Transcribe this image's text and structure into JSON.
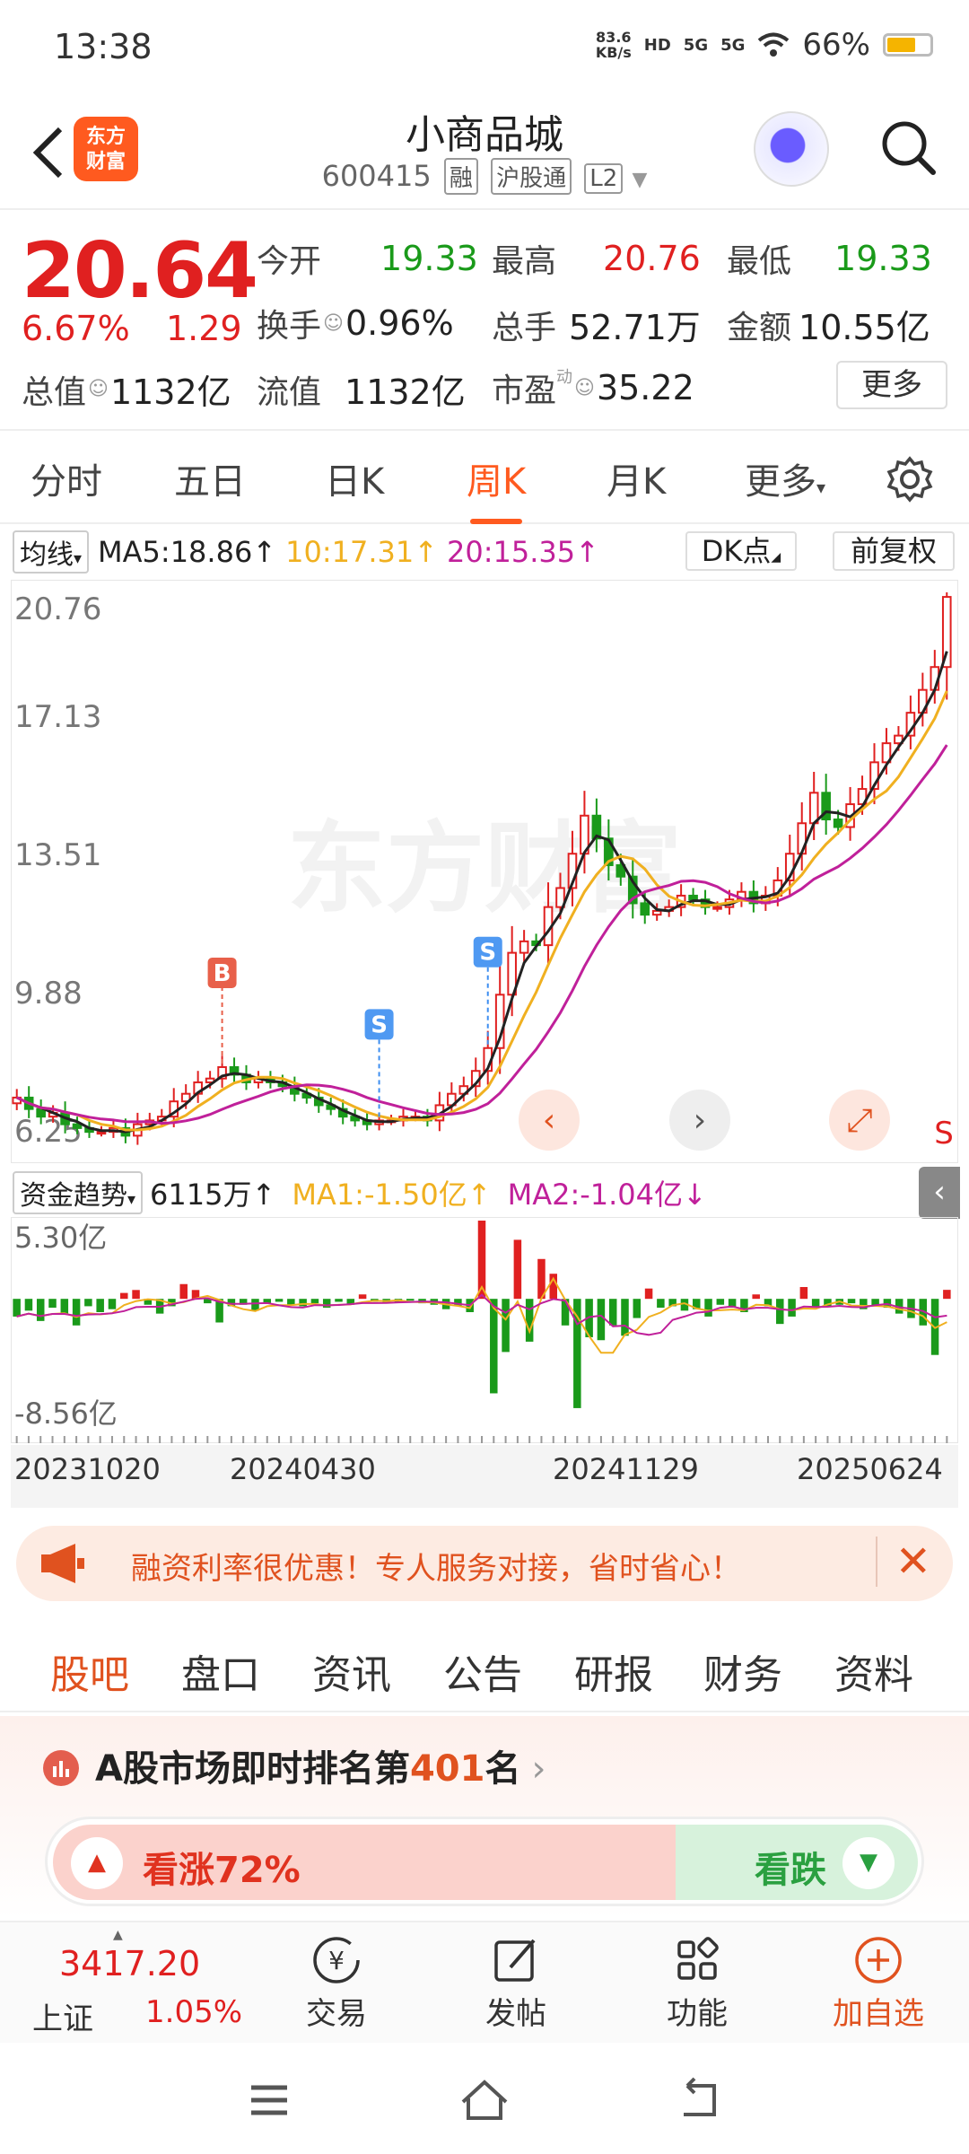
{
  "status": {
    "time": "13:38",
    "net_speed": "83.6",
    "net_unit": "KB/s",
    "hd": "HD",
    "sig1": "5G",
    "sig2": "5G",
    "battery": "66%"
  },
  "header": {
    "logo": "东方财富",
    "name": "小商品城",
    "code": "600415",
    "tags": [
      "融",
      "沪股通",
      "L2"
    ]
  },
  "quote": {
    "price": "20.64",
    "pct": "6.67%",
    "change": "1.29",
    "fields": [
      {
        "label": "今开",
        "value": "19.33",
        "color": "green"
      },
      {
        "label": "最高",
        "value": "20.76",
        "color": "red"
      },
      {
        "label": "最低",
        "value": "19.33",
        "color": "green"
      },
      {
        "label": "换手",
        "value": "0.96%",
        "color": "dark"
      },
      {
        "label": "总手",
        "value": "52.71万",
        "color": "dark"
      },
      {
        "label": "金额",
        "value": "10.55亿",
        "color": "dark"
      },
      {
        "label": "总值",
        "value": "1132亿",
        "color": "dark"
      },
      {
        "label": "流值",
        "value": "1132亿",
        "color": "dark"
      },
      {
        "label": "市盈",
        "value": "35.22",
        "color": "dark",
        "sup": "动"
      }
    ],
    "more": "更多"
  },
  "chart_tabs": [
    "分时",
    "五日",
    "日K",
    "周K",
    "月K",
    "更多"
  ],
  "active_chart_tab": "周K",
  "ma": {
    "selector": "均线",
    "ma5": "MA5:18.86",
    "ma10": "10:17.31",
    "ma20": "20:15.35",
    "dk": "DK点",
    "fq": "前复权",
    "colors": {
      "ma5": "#222222",
      "ma10": "#f0b020",
      "ma20": "#c0209a"
    }
  },
  "chart_data": {
    "type": "candlestick",
    "y_ticks": [
      "20.76",
      "17.13",
      "13.51",
      "9.88",
      "6.25"
    ],
    "ylim": [
      6.25,
      20.76
    ],
    "x_labels": [
      "20231020",
      "20240430",
      "20241129",
      "20250624"
    ],
    "markers": [
      {
        "label": "B",
        "index": 17
      },
      {
        "label": "S",
        "index": 30
      },
      {
        "label": "S",
        "index": 39
      },
      {
        "label": "S",
        "index": 77
      }
    ],
    "close": [
      7.5,
      7.2,
      7.0,
      7.1,
      6.8,
      6.7,
      6.6,
      6.6,
      6.7,
      6.5,
      6.8,
      6.9,
      7.0,
      7.4,
      7.6,
      7.9,
      8.0,
      8.3,
      8.1,
      7.9,
      8.0,
      7.9,
      7.8,
      7.6,
      7.5,
      7.3,
      7.2,
      7.0,
      6.9,
      6.8,
      6.9,
      6.9,
      7.0,
      7.0,
      6.9,
      7.3,
      7.6,
      7.8,
      8.2,
      8.8,
      10.2,
      11.3,
      11.6,
      11.5,
      12.5,
      13.0,
      13.9,
      14.9,
      14.3,
      13.6,
      13.3,
      12.6,
      12.3,
      12.4,
      12.5,
      12.8,
      12.7,
      12.5,
      12.5,
      12.7,
      12.9,
      12.6,
      12.8,
      13.2,
      13.9,
      14.7,
      15.5,
      14.8,
      14.6,
      15.2,
      15.6,
      16.3,
      16.8,
      17.0,
      17.6,
      18.2,
      18.8,
      20.64
    ],
    "fund_flow": {
      "label": "资金趋势",
      "value": "6115万",
      "ma1": "MA1:-1.50亿",
      "ma2": "MA2:-1.04亿",
      "ylim": [
        -8.56,
        5.3
      ],
      "y_ticks": [
        "5.30亿",
        "-8.56亿"
      ],
      "values": [
        -1.2,
        -0.8,
        -1.5,
        -0.6,
        -1.0,
        -1.8,
        -0.5,
        -0.9,
        -0.7,
        0.4,
        0.6,
        -0.4,
        -1.0,
        -0.5,
        1.0,
        0.6,
        -0.3,
        -1.6,
        -0.5,
        -0.4,
        -0.8,
        -0.3,
        -0.2,
        -0.4,
        -0.5,
        -0.3,
        -0.6,
        -0.2,
        -0.4,
        0.3,
        -0.2,
        -0.3,
        -0.2,
        -0.1,
        -0.3,
        -0.4,
        -0.7,
        -0.5,
        -0.9,
        5.3,
        -6.4,
        -3.6,
        4.0,
        -2.9,
        2.7,
        1.7,
        -1.8,
        -7.4,
        -2.6,
        -2.8,
        -1.8,
        -2.5,
        -1.3,
        0.7,
        -0.6,
        -0.5,
        -0.8,
        -0.7,
        -1.2,
        -0.4,
        -0.6,
        -0.9,
        0.3,
        -0.5,
        -1.7,
        -1.2,
        0.8,
        -0.6,
        -0.5,
        -0.4,
        -0.3,
        -0.7,
        -0.5,
        -0.6,
        -1.0,
        -1.3,
        -1.8,
        -3.8,
        0.61
      ]
    }
  },
  "promo": {
    "text": "融资利率很优惠！专人服务对接，省时省心！"
  },
  "content_tabs": [
    "股吧",
    "盘口",
    "资讯",
    "公告",
    "研报",
    "财务",
    "资料"
  ],
  "active_content_tab": "股吧",
  "rank": {
    "prefix": "A股市场即时排名第",
    "number": "401",
    "suffix": "名"
  },
  "vote": {
    "up": "看涨72%",
    "down": "看跌",
    "up_pct": 72
  },
  "bottom": {
    "index_value": "3417.20",
    "index_name": "上证",
    "index_pct": "1.05%",
    "nav": [
      {
        "label": "交易",
        "icon": "trade-icon"
      },
      {
        "label": "发帖",
        "icon": "post-icon"
      },
      {
        "label": "功能",
        "icon": "apps-icon"
      },
      {
        "label": "加自选",
        "icon": "add-favorite-icon"
      }
    ]
  }
}
